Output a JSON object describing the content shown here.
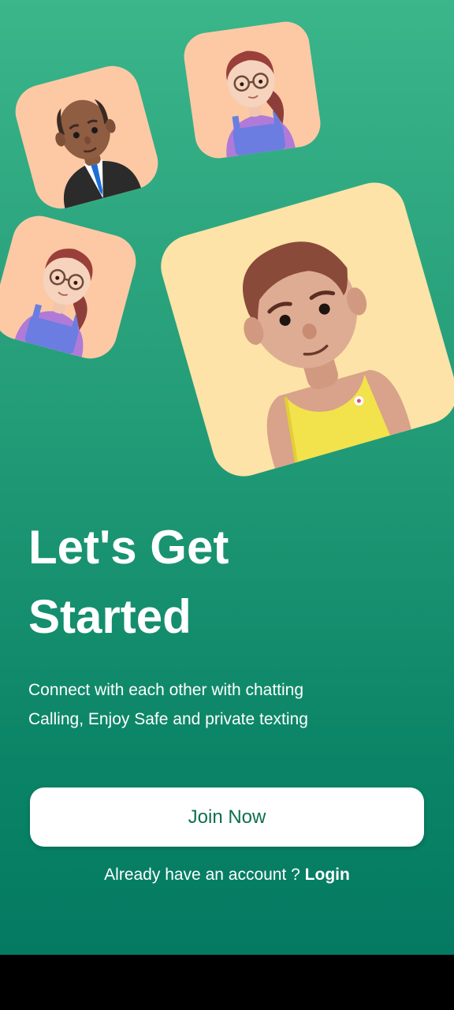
{
  "onboarding": {
    "avatars": [
      {
        "name": "bald-man-suit",
        "bg": "#fcc9a4"
      },
      {
        "name": "woman-glasses",
        "bg": "#fcc9a4"
      },
      {
        "name": "woman-glasses",
        "bg": "#fcc9a4"
      },
      {
        "name": "man-yellow-tank",
        "bg": "#fde3a7"
      }
    ],
    "title_line1": "Let's Get",
    "title_line2": "Started",
    "subtitle_line1": "Connect with each other with chatting",
    "subtitle_line2": "Calling, Enjoy Safe and private texting",
    "join_button": "Join Now",
    "login_prompt": "Already have an account ?",
    "login_link": "Login"
  },
  "colors": {
    "gradient_top": "#3bb58a",
    "gradient_bottom": "#047a62",
    "button_text": "#0f6e50",
    "tile_peach": "#fcc9a4",
    "tile_yellow": "#fde3a7"
  }
}
